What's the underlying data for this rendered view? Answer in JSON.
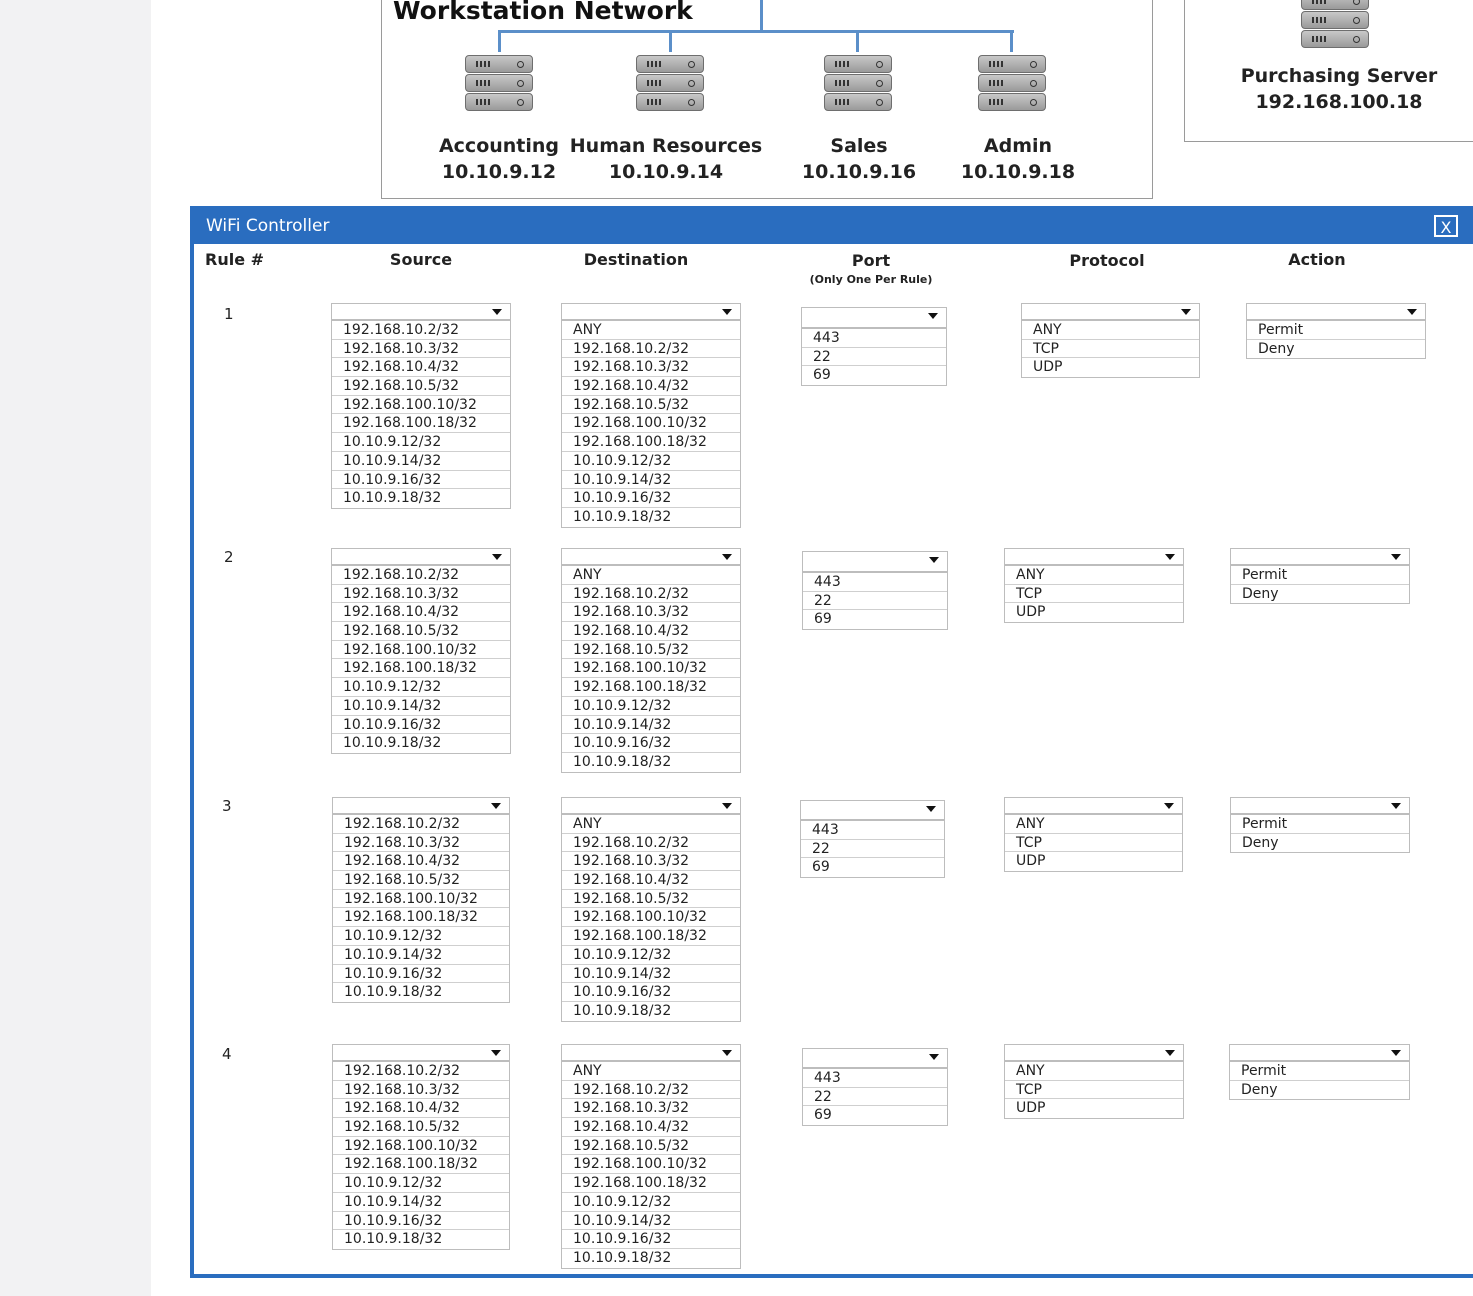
{
  "network": {
    "title": "Workstation Network",
    "hosts": [
      {
        "name": "Accounting",
        "ip": "10.10.9.12"
      },
      {
        "name": "Human Resources",
        "ip": "10.10.9.14"
      },
      {
        "name": "Sales",
        "ip": "10.10.9.16"
      },
      {
        "name": "Admin",
        "ip": "10.10.9.18"
      }
    ],
    "purchasing": {
      "name": "Purchasing Server",
      "ip": "192.168.100.18"
    }
  },
  "wifi": {
    "title": "WiFi Controller",
    "close_label": "X",
    "headers": {
      "rule": "Rule #",
      "source": "Source",
      "destination": "Destination",
      "port": "Port",
      "port_note": "(Only One Per Rule)",
      "protocol": "Protocol",
      "action": "Action"
    },
    "rule_numbers": [
      "1",
      "2",
      "3",
      "4"
    ],
    "source_options": [
      "192.168.10.2/32",
      "192.168.10.3/32",
      "192.168.10.4/32",
      "192.168.10.5/32",
      "192.168.100.10/32",
      "192.168.100.18/32",
      "10.10.9.12/32",
      "10.10.9.14/32",
      "10.10.9.16/32",
      "10.10.9.18/32"
    ],
    "destination_options": [
      "ANY",
      "192.168.10.2/32",
      "192.168.10.3/32",
      "192.168.10.4/32",
      "192.168.10.5/32",
      "192.168.100.10/32",
      "192.168.100.18/32",
      "10.10.9.12/32",
      "10.10.9.14/32",
      "10.10.9.16/32",
      "10.10.9.18/32"
    ],
    "port_options": [
      "443",
      "22",
      "69"
    ],
    "protocol_options": [
      "ANY",
      "TCP",
      "UDP"
    ],
    "action_options": [
      "Permit",
      "Deny"
    ]
  }
}
